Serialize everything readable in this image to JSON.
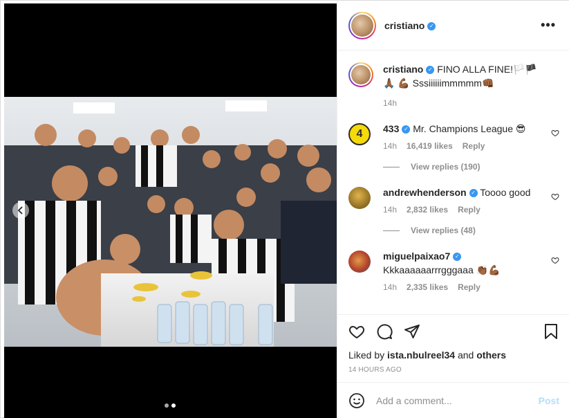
{
  "post": {
    "username": "cristiano",
    "verified": true,
    "more_icon": "more-horizontal-icon",
    "carousel_count": 2,
    "carousel_active": 2
  },
  "caption": {
    "username": "cristiano",
    "text": "FINO ALLA FINE!🏳️🏴🙏🏾 💪🏾 Sssiiiiiimmmmm👊🏾",
    "time": "14h"
  },
  "comments": [
    {
      "username": "433",
      "verified": true,
      "text": "Mr. Champions League 😎",
      "time": "14h",
      "likes": "16,419 likes",
      "reply": "Reply",
      "view_replies": "View replies (190)",
      "avatar_color": "#f5d90a"
    },
    {
      "username": "andrewhenderson",
      "verified": true,
      "text": "Toooo good",
      "time": "14h",
      "likes": "2,832 likes",
      "reply": "Reply",
      "view_replies": "View replies (48)",
      "avatar_color": "#c59a3a"
    },
    {
      "username": "miguelpaixao7",
      "verified": true,
      "text": "Kkkaaaaaarrrgggaaa 👏🏾💪🏾",
      "time": "14h",
      "likes": "2,335 likes",
      "reply": "Reply",
      "avatar_color": "#8a6a4a"
    }
  ],
  "liked_by": {
    "prefix": "Liked by",
    "user": "ista.nbulreel34",
    "and": "and",
    "others": "others"
  },
  "timestamp": "14 HOURS AGO",
  "add_comment": {
    "placeholder": "Add a comment...",
    "post_label": "Post"
  },
  "colors": {
    "link_blue": "#3897f0",
    "post_disabled": "#b2dffc",
    "muted": "#8e8e8e"
  }
}
